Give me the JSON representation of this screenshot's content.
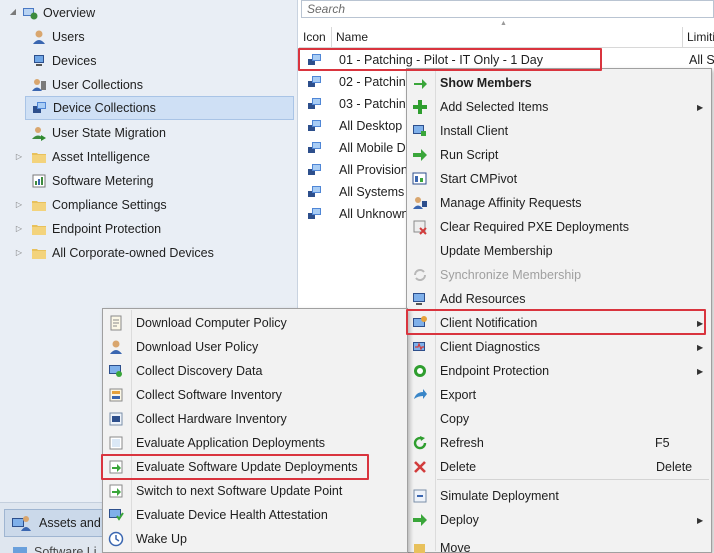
{
  "nav": {
    "items": [
      {
        "label": "Overview",
        "icon": "overview-icon"
      },
      {
        "label": "Users",
        "icon": "user-icon"
      },
      {
        "label": "Devices",
        "icon": "devices-icon"
      },
      {
        "label": "User Collections",
        "icon": "user-collections-icon"
      },
      {
        "label": "Device Collections",
        "icon": "device-collections-icon"
      },
      {
        "label": "User State Migration",
        "icon": "user-state-migration-icon"
      },
      {
        "label": "Asset Intelligence",
        "icon": "folder-icon"
      },
      {
        "label": "Software Metering",
        "icon": "software-metering-icon"
      },
      {
        "label": "Compliance Settings",
        "icon": "folder-icon"
      },
      {
        "label": "Endpoint Protection",
        "icon": "folder-icon"
      },
      {
        "label": "All Corporate-owned Devices",
        "icon": "folder-icon"
      }
    ],
    "workspace_button": "Assets and",
    "workspace_next": "Software Li"
  },
  "list": {
    "search_placeholder": "Search",
    "columns": {
      "icon": "Icon",
      "name": "Name",
      "limiting": "Limiti"
    },
    "rows": [
      {
        "name": "01 - Patching - Pilot - IT Only - 1 Day",
        "limiting": "All Sy"
      },
      {
        "name": "02 - Patching",
        "limiting": ""
      },
      {
        "name": "03 - Patching",
        "limiting": ""
      },
      {
        "name": "All Desktop a",
        "limiting": ""
      },
      {
        "name": "All Mobile D",
        "limiting": ""
      },
      {
        "name": "All Provision",
        "limiting": ""
      },
      {
        "name": "All Systems",
        "limiting": ""
      },
      {
        "name": "All Unknown",
        "limiting": ""
      }
    ]
  },
  "context_menu": {
    "items": [
      {
        "label": "Show Members",
        "icon": "show-members-icon",
        "bold": true
      },
      {
        "label": "Add Selected Items",
        "icon": "add-icon",
        "submenu": true
      },
      {
        "label": "Install Client",
        "icon": "install-client-icon"
      },
      {
        "label": "Run Script",
        "icon": "run-script-icon"
      },
      {
        "label": "Start CMPivot",
        "icon": "cmpivot-icon"
      },
      {
        "label": "Manage Affinity Requests",
        "icon": "affinity-icon"
      },
      {
        "label": "Clear Required PXE Deployments",
        "icon": "pxe-icon"
      },
      {
        "label": "Update Membership",
        "icon": "update-membership-icon"
      },
      {
        "label": "Synchronize Membership",
        "icon": "sync-icon",
        "disabled": true
      },
      {
        "label": "Add Resources",
        "icon": "add-resources-icon"
      },
      {
        "label": "Client Notification",
        "icon": "client-notification-icon",
        "submenu": true
      },
      {
        "label": "Client Diagnostics",
        "icon": "client-diagnostics-icon",
        "submenu": true
      },
      {
        "label": "Endpoint Protection",
        "icon": "endpoint-protection-icon",
        "submenu": true
      },
      {
        "label": "Export",
        "icon": "export-icon"
      },
      {
        "label": "Copy",
        "icon": "copy-icon"
      },
      {
        "label": "Refresh",
        "icon": "refresh-icon",
        "shortcut": "F5"
      },
      {
        "label": "Delete",
        "icon": "delete-icon",
        "shortcut": "Delete"
      },
      {
        "label": "Simulate Deployment",
        "icon": "simulate-icon"
      },
      {
        "label": "Deploy",
        "icon": "deploy-icon",
        "submenu": true
      },
      {
        "label": "Move",
        "icon": "move-icon"
      }
    ]
  },
  "submenu": {
    "items": [
      {
        "label": "Download Computer Policy",
        "icon": "computer-policy-icon"
      },
      {
        "label": "Download User Policy",
        "icon": "user-policy-icon"
      },
      {
        "label": "Collect Discovery Data",
        "icon": "discovery-data-icon"
      },
      {
        "label": "Collect Software Inventory",
        "icon": "software-inventory-icon"
      },
      {
        "label": "Collect Hardware Inventory",
        "icon": "hardware-inventory-icon"
      },
      {
        "label": "Evaluate Application Deployments",
        "icon": "app-deployments-icon"
      },
      {
        "label": "Evaluate Software Update Deployments",
        "icon": "software-update-icon"
      },
      {
        "label": "Switch to next Software Update Point",
        "icon": "switch-sup-icon"
      },
      {
        "label": "Evaluate Device Health Attestation",
        "icon": "device-health-icon"
      },
      {
        "label": "Wake Up",
        "icon": "wake-up-icon"
      }
    ]
  },
  "colors": {
    "highlight": "#d9343e",
    "selection": "#cfe0f5"
  }
}
